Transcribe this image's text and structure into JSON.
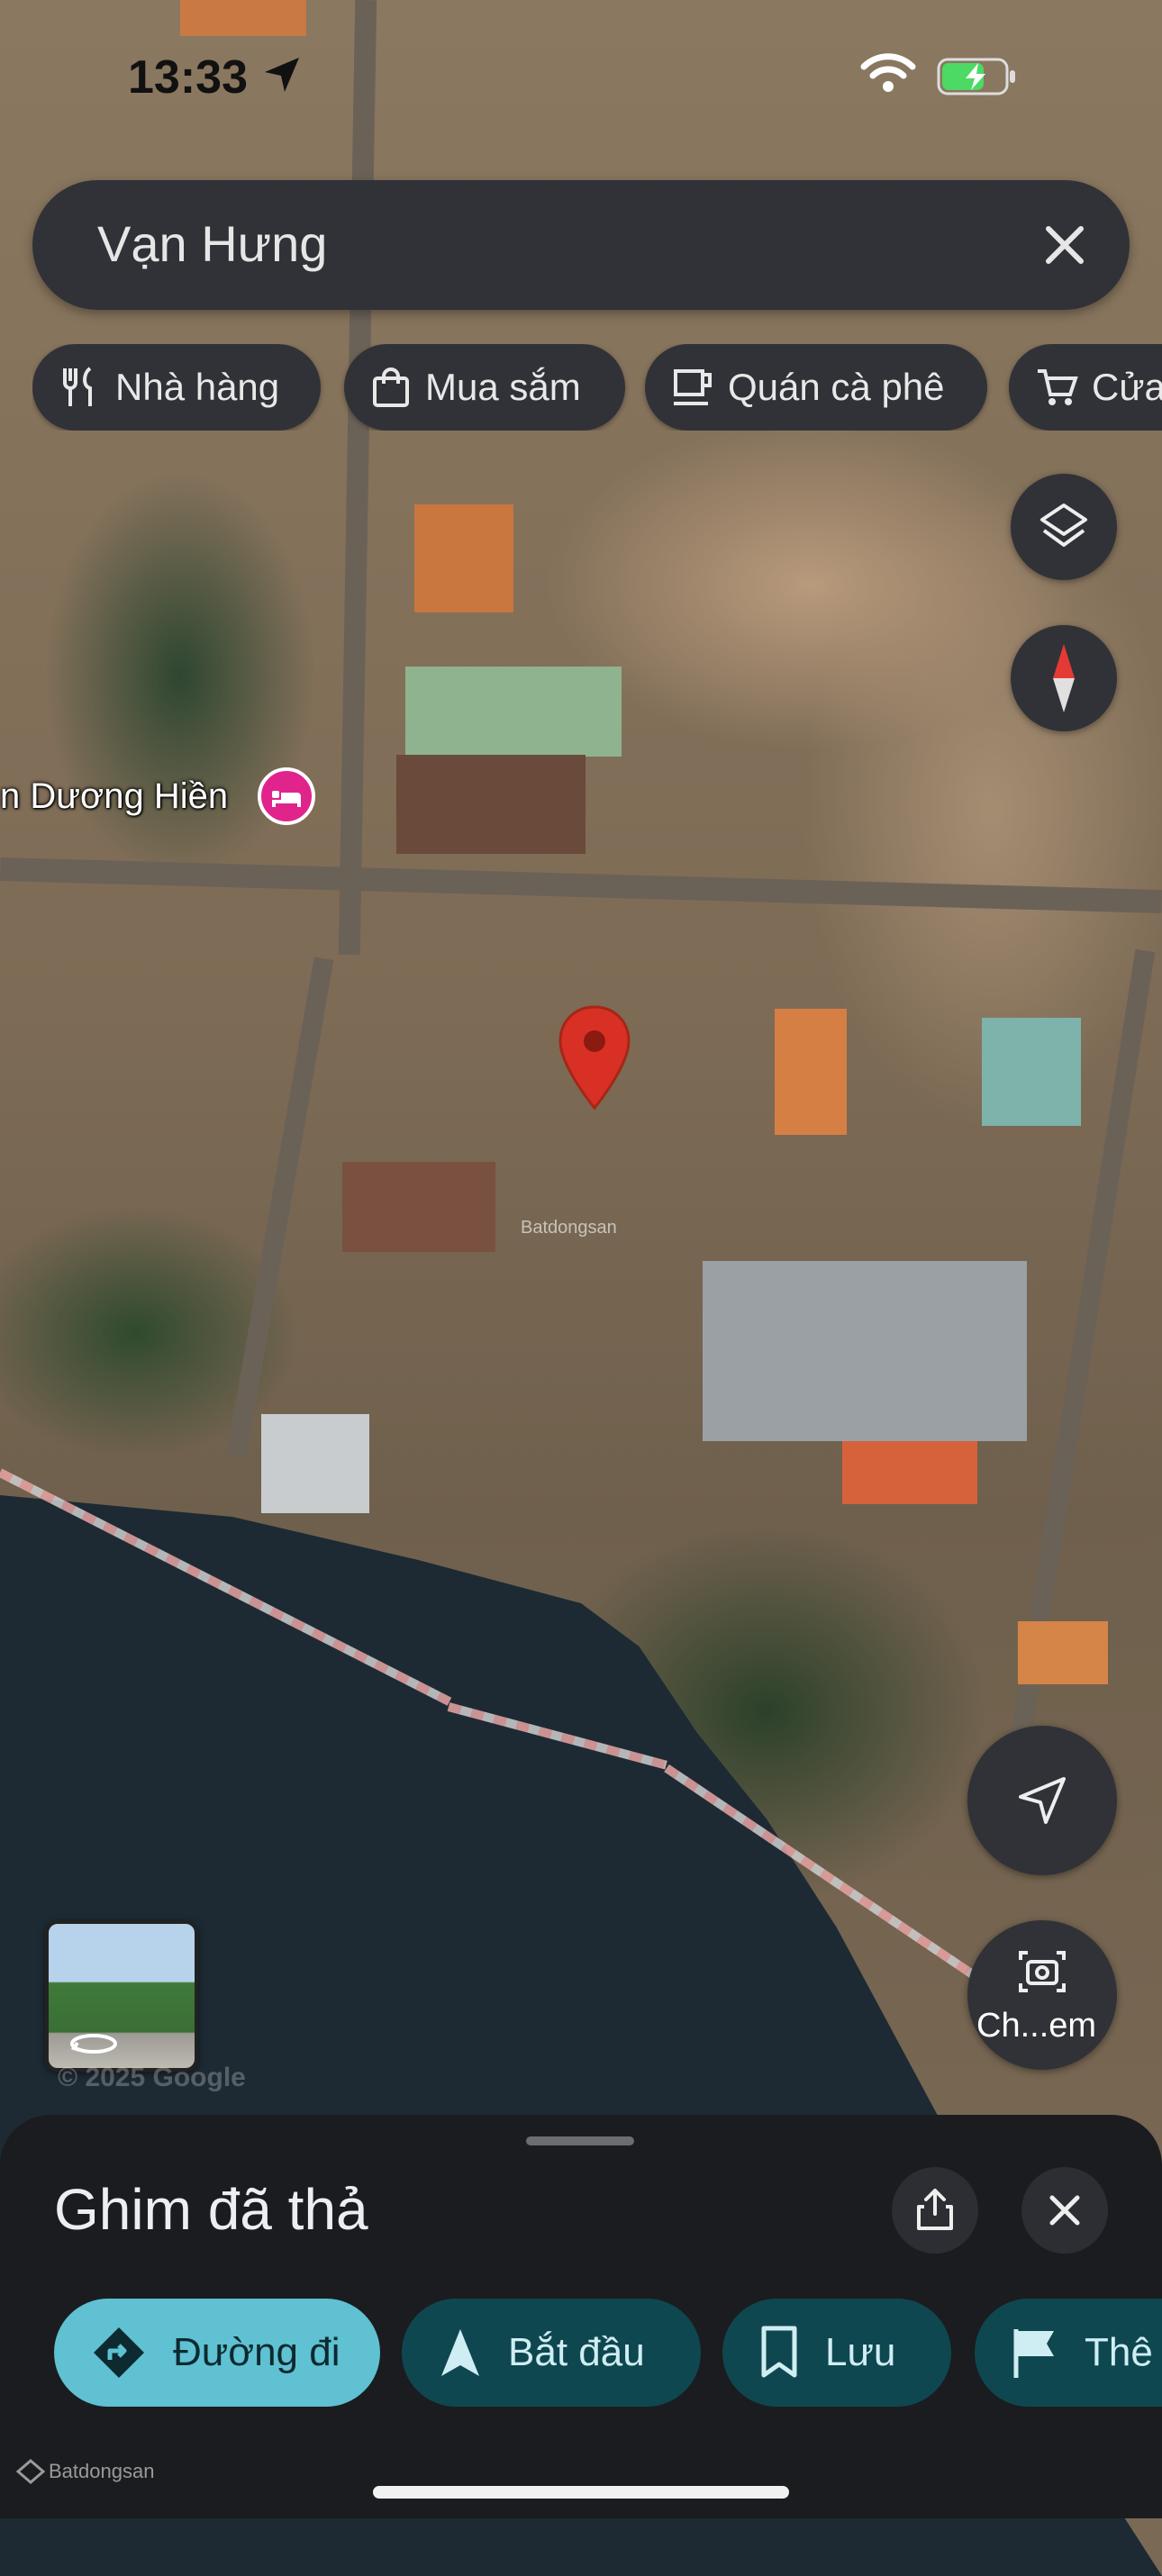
{
  "status_bar": {
    "time": "13:33",
    "icons": [
      "location-arrow-icon",
      "wifi-icon",
      "battery-charging-icon"
    ]
  },
  "search": {
    "query": "Vạn Hưng",
    "close_icon": "close-icon"
  },
  "category_chips": [
    {
      "label": "Nhà hàng",
      "icon": "fork-knife-icon"
    },
    {
      "label": "Mua sắm",
      "icon": "shopping-bag-icon"
    },
    {
      "label": "Quán cà phê",
      "icon": "coffee-cup-icon"
    },
    {
      "label": "Cửa",
      "icon": "shopping-cart-icon"
    }
  ],
  "map": {
    "poi_label": "n Dương Hiền",
    "poi_icon": "bed-icon",
    "watermark": "Batdongsan",
    "attribution": "© 2025 Google",
    "layers_icon": "layers-icon",
    "compass_icon": "compass-icon",
    "my_location_icon": "navigation-arrow-icon",
    "camera_label": "Ch...em",
    "camera_icon": "camera-search-icon"
  },
  "bottom_sheet": {
    "title": "Ghim đã thả",
    "actions": [
      {
        "label": "Đường đi",
        "icon": "directions-icon"
      },
      {
        "label": "Bắt đầu",
        "icon": "navigation-start-icon"
      },
      {
        "label": "Lưu",
        "icon": "bookmark-icon"
      },
      {
        "label": "Thê",
        "icon": "flag-icon"
      }
    ]
  },
  "footer": {
    "brand": "Batdongsan"
  },
  "colors": {
    "chip_bg": "#303237",
    "primary_action": "#5fc1d1",
    "tonal_action": "#0f4750",
    "pin_red": "#d93025",
    "hotel_pink": "#e0248c"
  }
}
